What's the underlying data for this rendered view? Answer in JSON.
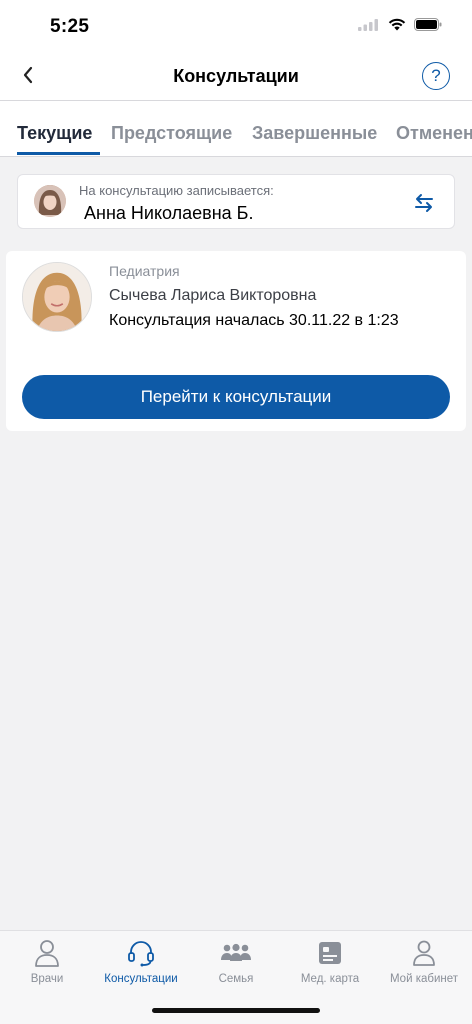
{
  "status_bar": {
    "time": "5:25"
  },
  "nav": {
    "title": "Консультации",
    "help_label": "?"
  },
  "tabs": [
    {
      "label": "Текущие",
      "active": true
    },
    {
      "label": "Предстоящие",
      "active": false
    },
    {
      "label": "Завершенные",
      "active": false
    },
    {
      "label": "Отменен",
      "active": false
    }
  ],
  "patient": {
    "caption": "На консультацию записывается:",
    "name": "Анна Николаевна Б."
  },
  "consultation": {
    "specialty": "Педиатрия",
    "doctor_name": "Сычева Лариса Викторовна",
    "status": "Консультация началась 30.11.22 в 1:23",
    "button_label": "Перейти к консультации"
  },
  "bottom_tabs": [
    {
      "label": "Врачи",
      "icon": "doctor-icon",
      "active": false
    },
    {
      "label": "Консультации",
      "icon": "headset-icon",
      "active": true
    },
    {
      "label": "Семья",
      "icon": "family-icon",
      "active": false
    },
    {
      "label": "Мед. карта",
      "icon": "medcard-icon",
      "active": false
    },
    {
      "label": "Мой кабинет",
      "icon": "profile-icon",
      "active": false
    }
  ],
  "colors": {
    "accent": "#0e5aa7",
    "inactive": "#8a8f98",
    "background": "#f2f2f3"
  }
}
